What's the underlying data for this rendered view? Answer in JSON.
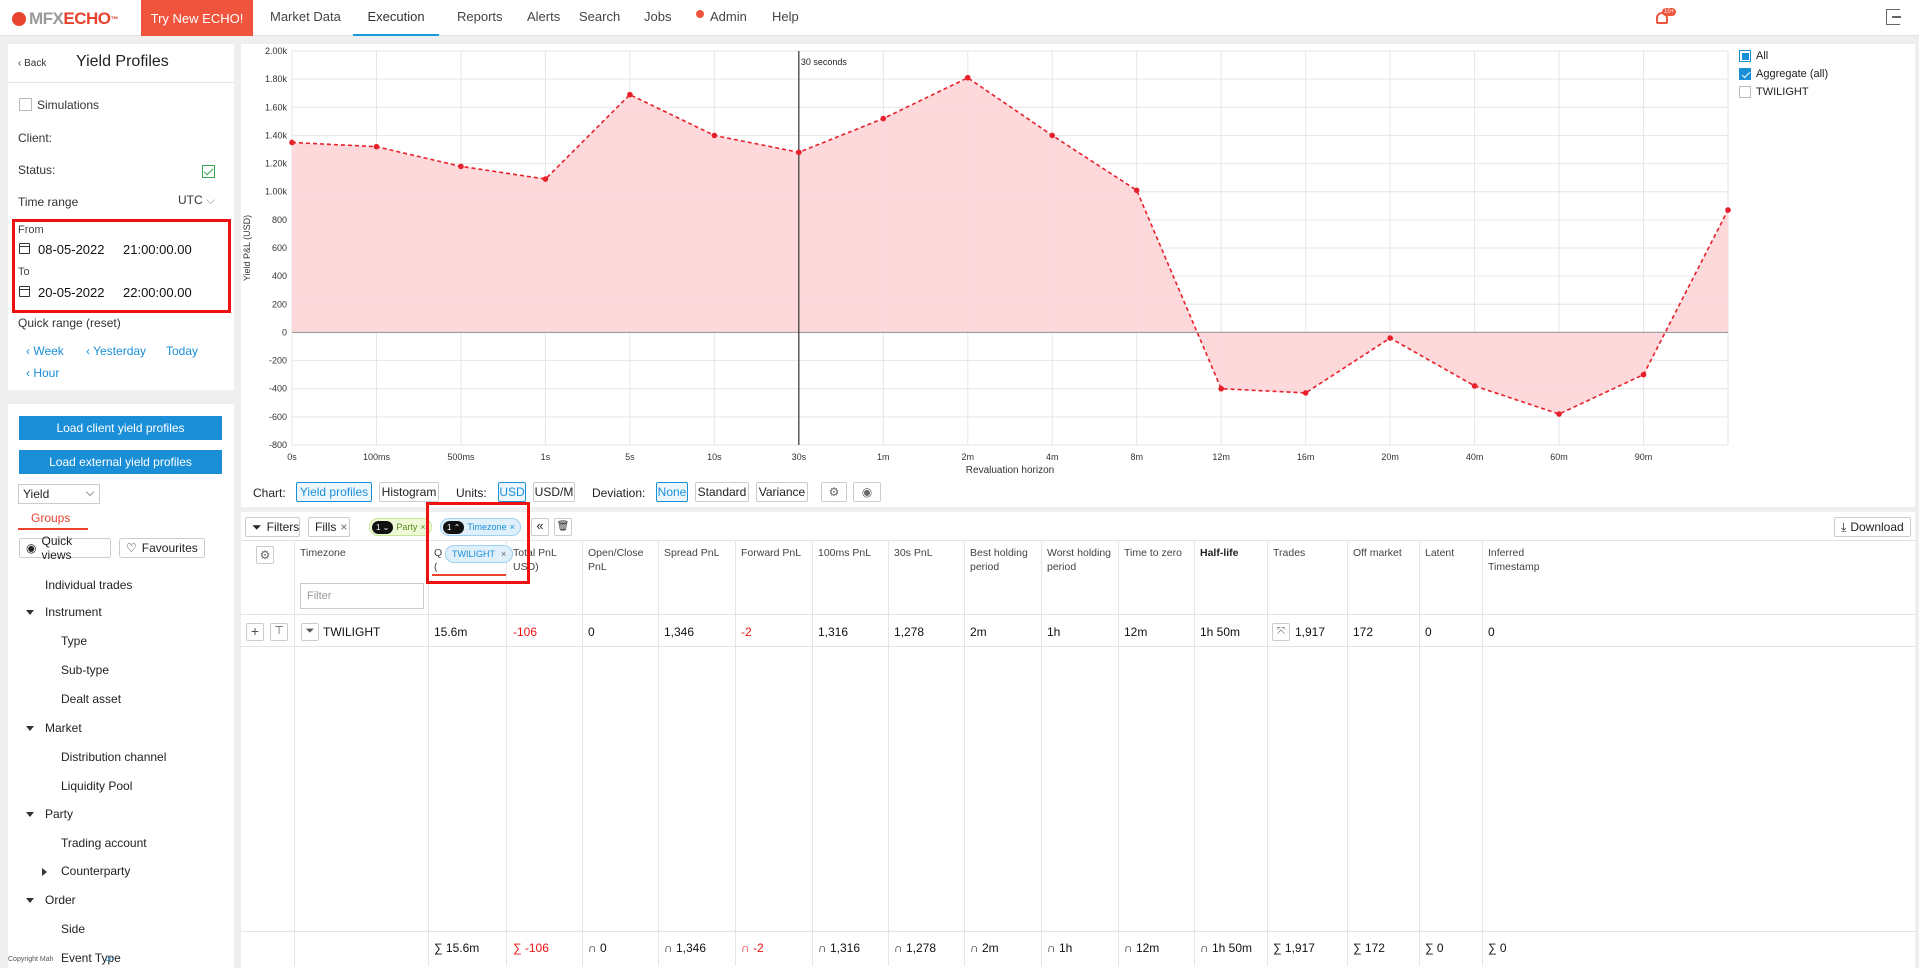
{
  "nav": {
    "logo_a": "MFX",
    "logo_b": "ECHO",
    "logo_tm": "™",
    "try_button": "Try New ECHO!",
    "items": [
      "Market Data",
      "Execution",
      "Reports",
      "Alerts",
      "Search",
      "Jobs",
      "Admin",
      "Help"
    ],
    "active": "Execution",
    "notif_count": "10+"
  },
  "left": {
    "back": "Back",
    "title": "Yield Profiles",
    "simulations": "Simulations",
    "client_label": "Client:",
    "status_label": "Status:",
    "time_range_label": "Time range",
    "timezone": "UTC",
    "from_label": "From",
    "from_date": "08-05-2022",
    "from_time": "21:00:00.00",
    "to_label": "To",
    "to_date": "20-05-2022",
    "to_time": "22:00:00.00",
    "quick_range": "Quick range (reset)",
    "quick_links": [
      "Week",
      "Yesterday",
      "Today",
      "Hour"
    ],
    "load_client": "Load client yield profiles",
    "load_external": "Load external yield profiles",
    "metric_select": "Yield",
    "groups_tab": "Groups",
    "quick_views": "Quick views",
    "favourites": "Favourites",
    "tree": [
      "Individual trades",
      "Instrument",
      "Type",
      "Sub-type",
      "Dealt asset",
      "Market",
      "Distribution channel",
      "Liquidity Pool",
      "Party",
      "Trading account",
      "Counterparty",
      "Order",
      "Side",
      "Event Type"
    ],
    "copyright_a": "Copyright Mah",
    "copyright_b": "on"
  },
  "chart_data": {
    "type": "area",
    "x": [
      "0s",
      "100ms",
      "500ms",
      "1s",
      "5s",
      "10s",
      "30s",
      "1m",
      "2m",
      "4m",
      "8m",
      "12m",
      "16m",
      "20m",
      "40m",
      "60m",
      "90m",
      ""
    ],
    "values": [
      1350,
      1320,
      1180,
      1090,
      1690,
      1400,
      1280,
      1520,
      1810,
      1400,
      1010,
      -400,
      -430,
      -40,
      -380,
      -580,
      -300,
      870
    ],
    "ylabel": "Yield P&L (USD)",
    "xlabel": "Revaluation horizon",
    "yticks": [
      "2.00k",
      "1.80k",
      "1.60k",
      "1.40k",
      "1.20k",
      "1.00k",
      "800",
      "600",
      "400",
      "200",
      "0",
      "-200",
      "-400",
      "-600",
      "-800"
    ],
    "ylim": [
      -800,
      2000
    ],
    "marker_label": "30 seconds",
    "marker_at": "30s",
    "legend": [
      "All",
      "Aggregate (all)",
      "TWILIGHT"
    ],
    "line_color": "#e8202a",
    "fill_color": "#fdd5d8"
  },
  "toolbar": {
    "chart_label": "Chart:",
    "chart_opts": [
      "Yield profiles",
      "Histogram"
    ],
    "units_label": "Units:",
    "units_opts": [
      "USD",
      "USD/M"
    ],
    "deviation_label": "Deviation:",
    "deviation_opts": [
      "None",
      "Standard",
      "Variance"
    ]
  },
  "grid": {
    "filters": "Filters",
    "fills": "Fills",
    "party_chip": "Party",
    "party_n": "1",
    "timezone_chip": "Timezone",
    "timezone_n": "1",
    "download": "Download",
    "twilight_chip": "TWILIGHT",
    "filter_placeholder": "Filter",
    "headers": [
      "Timezone",
      "Q\n(",
      "Total PnL\nUSD)",
      "Open/Close\nPnL",
      "Spread PnL",
      "Forward PnL",
      "100ms PnL",
      "30s PnL",
      "Best holding\nperiod",
      "Worst holding\nperiod",
      "Time to zero",
      "Half-life",
      "Trades",
      "Off market",
      "Latent",
      "Inferred\nTimestamp"
    ],
    "row": [
      "TWILIGHT",
      "15.6m",
      "-106",
      "0",
      "1,346",
      "-2",
      "1,316",
      "1,278",
      "2m",
      "1h",
      "12m",
      "1h 50m",
      "1,917",
      "172",
      "0",
      "0"
    ],
    "footer": [
      "∑ 15.6m",
      "∑ -106",
      "∩ 0",
      "∩ 1,346",
      "∩ -2",
      "∩ 1,316",
      "∩ 1,278",
      "∩ 2m",
      "∩ 1h",
      "∩ 12m",
      "∩ 1h 50m",
      "∑ 1,917",
      "∑ 172",
      "∑ 0",
      "∑ 0"
    ]
  }
}
